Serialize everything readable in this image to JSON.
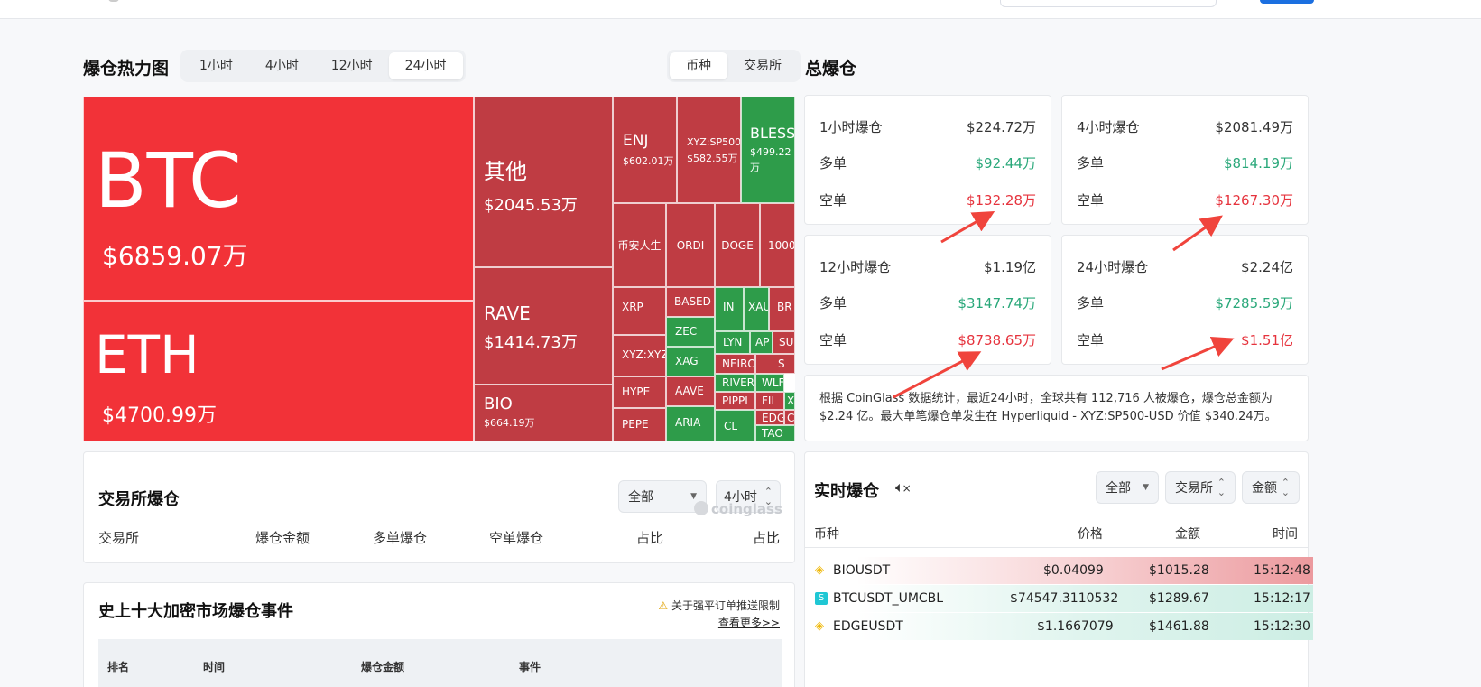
{
  "heatmap": {
    "title": "爆仓热力图",
    "time_tabs": [
      "1小时",
      "4小时",
      "12小时",
      "24小时"
    ],
    "active_tab": "24小时",
    "view_tabs": [
      "币种",
      "交易所"
    ],
    "tiles": [
      {
        "name": "BTC",
        "value": "$6859.07万"
      },
      {
        "name": "ETH",
        "value": "$4700.99万"
      },
      {
        "name": "其他",
        "value": "$2045.53万"
      },
      {
        "name": "RAVE",
        "value": "$1414.73万"
      },
      {
        "name": "BIO",
        "value": "$664.19万"
      },
      {
        "name": "ENJ",
        "value": "$602.01万"
      },
      {
        "name": "XYZ:SP500",
        "value": "$582.55万"
      },
      {
        "name": "BLESS",
        "value": "$499.22万"
      },
      {
        "name": "币安人生"
      },
      {
        "name": "ORDI"
      },
      {
        "name": "DOGE"
      },
      {
        "name": "1000"
      },
      {
        "name": "XRP"
      },
      {
        "name": "BASED"
      },
      {
        "name": "IN"
      },
      {
        "name": "XAU"
      },
      {
        "name": "BR"
      },
      {
        "name": "ZEC"
      },
      {
        "name": "LYN"
      },
      {
        "name": "AP"
      },
      {
        "name": "SU"
      },
      {
        "name": "XYZ:XYZ"
      },
      {
        "name": "XAG"
      },
      {
        "name": "NEIRO"
      },
      {
        "name": "S"
      },
      {
        "name": "RIVER"
      },
      {
        "name": "WLF"
      },
      {
        "name": "HYPE"
      },
      {
        "name": "AAVE"
      },
      {
        "name": "FIL"
      },
      {
        "name": "X"
      },
      {
        "name": "PIPPI"
      },
      {
        "name": "EDG"
      },
      {
        "name": "C"
      },
      {
        "name": "PEPE"
      },
      {
        "name": "ARIA"
      },
      {
        "name": "CL"
      },
      {
        "name": "TAO"
      }
    ]
  },
  "total": {
    "title": "总爆仓",
    "cards": [
      {
        "label": "1小时爆仓",
        "total": "$224.72万",
        "long_label": "多单",
        "long": "$92.44万",
        "short_label": "空单",
        "short": "$132.28万"
      },
      {
        "label": "4小时爆仓",
        "total": "$2081.49万",
        "long_label": "多单",
        "long": "$814.19万",
        "short_label": "空单",
        "short": "$1267.30万"
      },
      {
        "label": "12小时爆仓",
        "total": "$1.19亿",
        "long_label": "多单",
        "long": "$3147.74万",
        "short_label": "空单",
        "short": "$8738.65万"
      },
      {
        "label": "24小时爆仓",
        "total": "$2.24亿",
        "long_label": "多单",
        "long": "$7285.59万",
        "short_label": "空单",
        "short": "$1.51亿"
      }
    ],
    "summary": "根据 CoinGlass 数据统计，最近24小时，全球共有 112,716 人被爆仓，爆仓总金额为 $2.24 亿。最大单笔爆仓单发生在 Hyperliquid - XYZ:SP500-USD 价值 $340.24万。"
  },
  "exchange": {
    "title": "交易所爆仓",
    "filter": "全部",
    "period": "4小时",
    "watermark": "coinglass",
    "columns": [
      "交易所",
      "爆仓金额",
      "多单爆仓",
      "空单爆仓",
      "占比",
      "占比"
    ]
  },
  "top10": {
    "title": "史上十大加密市场爆仓事件",
    "notice": "关于强平订单推送限制",
    "more": "查看更多>>",
    "columns": [
      "排名",
      "时间",
      "爆仓金额",
      "事件"
    ]
  },
  "realtime": {
    "title": "实时爆仓",
    "filter_all": "全部",
    "filter_exchange": "交易所",
    "filter_amount": "金额",
    "columns": [
      "币种",
      "价格",
      "金额",
      "时间"
    ],
    "rows": [
      {
        "symbol": "BIOUSDT",
        "price": "$0.04099",
        "amount": "$1015.28",
        "time": "15:12:48",
        "side": "sell",
        "ex": "binance"
      },
      {
        "symbol": "BTCUSDT_UMCBL",
        "price": "$74547.3110532",
        "amount": "$1289.67",
        "time": "15:12:17",
        "side": "buy",
        "ex": "bitget"
      },
      {
        "symbol": "EDGEUSDT",
        "price": "$1.1667079",
        "amount": "$1461.88",
        "time": "15:12:30",
        "side": "buy",
        "ex": "binance"
      }
    ]
  },
  "colors": {
    "red_main": "#f23238",
    "red_dark": "#bf3c43",
    "green": "#2e9c4a",
    "up": "#2aa87a",
    "down": "#e6333d",
    "arrow": "#f0443c"
  }
}
